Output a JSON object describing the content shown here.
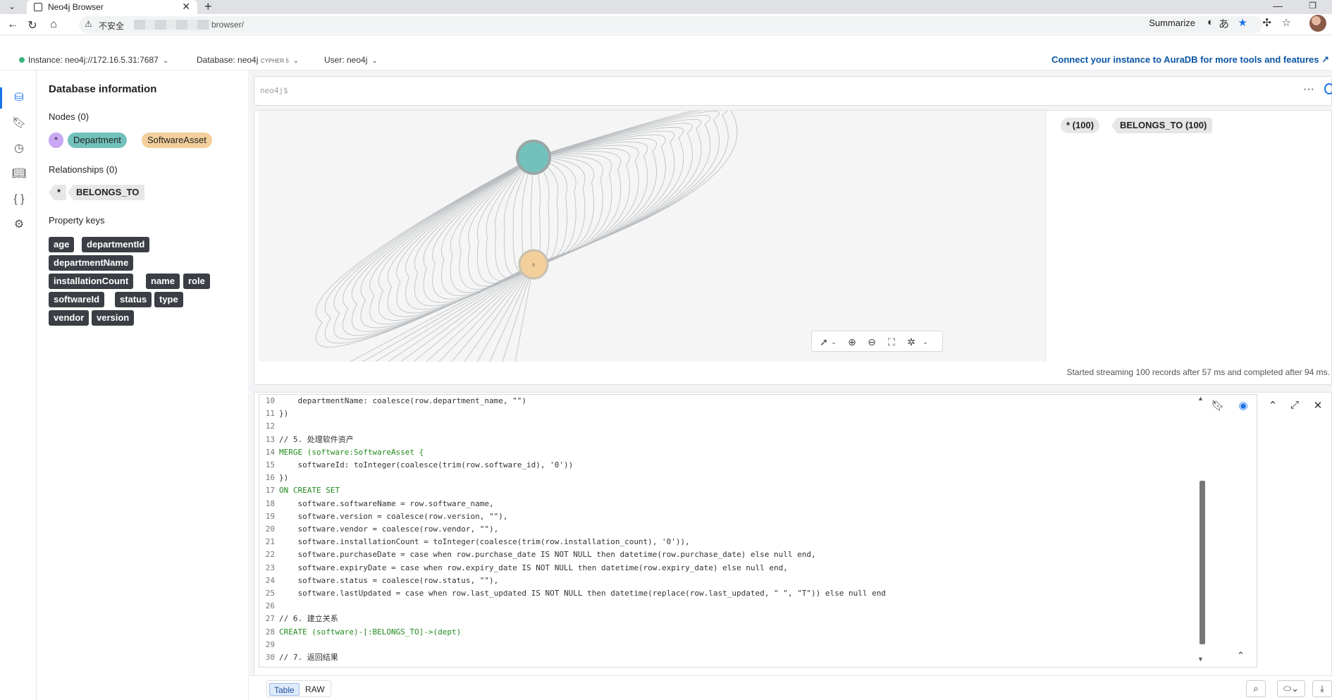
{
  "browser": {
    "tab_title": "Neo4j Browser",
    "insecure_label": "不安全",
    "url_visible": "browser/",
    "summarize_label": "Summarize"
  },
  "header": {
    "instance": "Instance: neo4j://172.16.5.31:7687",
    "database": "Database: neo4j",
    "cypher": "CYPHER 5",
    "user": "User: neo4j",
    "aura_link": "Connect your instance to AuraDB for more tools and features ↗"
  },
  "dbinfo": {
    "title": "Database information",
    "nodes_title": "Nodes (0)",
    "node_labels": [
      "*",
      "Department",
      "SoftwareAsset"
    ],
    "relationships_title": "Relationships (0)",
    "rel_types": [
      "*",
      "BELONGS_TO"
    ],
    "property_keys_title": "Property keys",
    "property_keys": [
      "age",
      "departmentId",
      "departmentName",
      "installationCount",
      "name",
      "role",
      "softwareId",
      "status",
      "type",
      "vendor",
      "version"
    ]
  },
  "editor": {
    "prompt": "neo4j$",
    "more": "···"
  },
  "result": {
    "overview": [
      "* (100)",
      "BELONGS_TO (100)"
    ],
    "status": "Started streaming 100 records after 57 ms and completed after 94 ms.",
    "node_caption": "0"
  },
  "code_lines": [
    {
      "n": "10",
      "t": "    departmentName: coalesce(row.department_name, \"\")"
    },
    {
      "n": "11",
      "t": "})"
    },
    {
      "n": "12",
      "t": ""
    },
    {
      "n": "13",
      "t": "// 5. 处理软件资产"
    },
    {
      "n": "14",
      "t": "MERGE (software:SoftwareAsset {"
    },
    {
      "n": "15",
      "t": "    softwareId: toInteger(coalesce(trim(row.software_id), '0'))"
    },
    {
      "n": "16",
      "t": "})"
    },
    {
      "n": "17",
      "t": "ON CREATE SET"
    },
    {
      "n": "18",
      "t": "    software.softwareName = row.software_name,"
    },
    {
      "n": "19",
      "t": "    software.version = coalesce(row.version, \"\"),"
    },
    {
      "n": "20",
      "t": "    software.vendor = coalesce(row.vendor, \"\"),"
    },
    {
      "n": "21",
      "t": "    software.installationCount = toInteger(coalesce(trim(row.installation_count), '0')),"
    },
    {
      "n": "22",
      "t": "    software.purchaseDate = case when row.purchase_date IS NOT NULL then datetime(row.purchase_date) else null end,"
    },
    {
      "n": "23",
      "t": "    software.expiryDate = case when row.expiry_date IS NOT NULL then datetime(row.expiry_date) else null end,"
    },
    {
      "n": "24",
      "t": "    software.status = coalesce(row.status, \"\"),"
    },
    {
      "n": "25",
      "t": "    software.lastUpdated = case when row.last_updated IS NOT NULL then datetime(replace(row.last_updated, \" \", \"T\")) else null end"
    },
    {
      "n": "26",
      "t": ""
    },
    {
      "n": "27",
      "t": "// 6. 建立关系"
    },
    {
      "n": "28",
      "t": "CREATE (software)-[:BELONGS_TO]->(dept)"
    },
    {
      "n": "29",
      "t": ""
    },
    {
      "n": "30",
      "t": "// 7. 返回结果"
    }
  ],
  "bottom": {
    "tab_table": "Table",
    "tab_raw": "RAW"
  },
  "colors": {
    "department": "#72c1bd",
    "software_asset": "#f3cf9b",
    "star": "#c9a7f2",
    "accent": "#1a73e8"
  }
}
